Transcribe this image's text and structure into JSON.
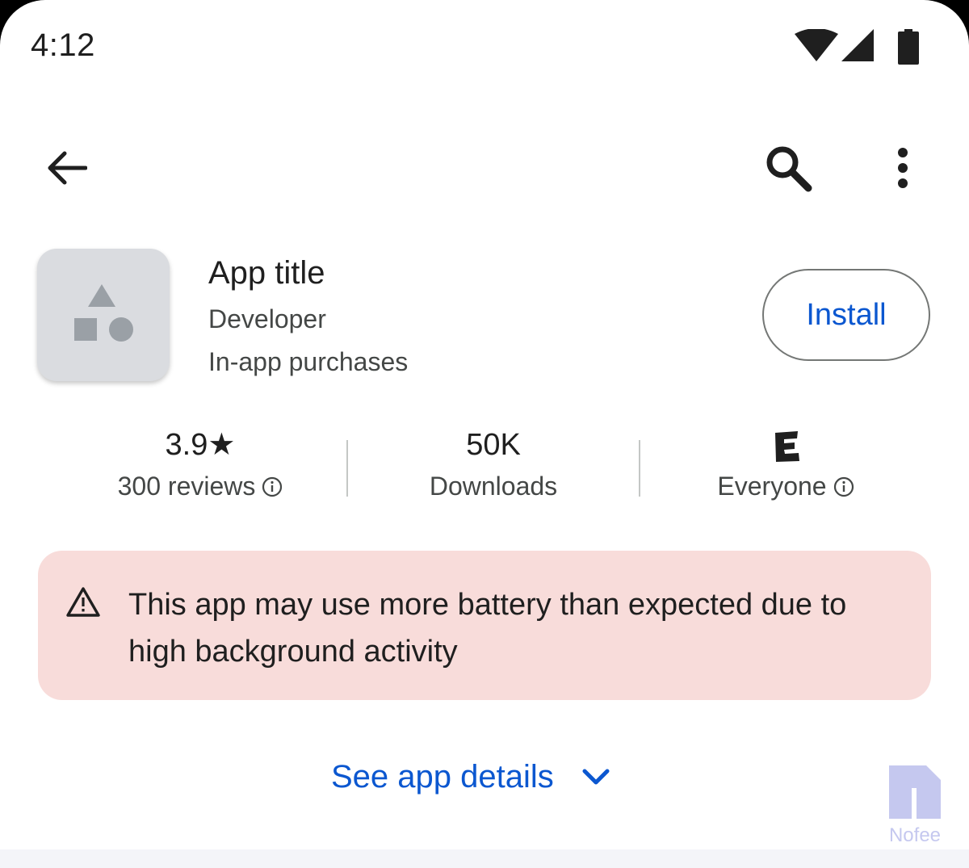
{
  "status_bar": {
    "time": "4:12",
    "icons": [
      "wifi-icon",
      "cellular-signal-icon",
      "battery-icon"
    ]
  },
  "top_bar": {
    "icons": [
      "back-arrow-icon",
      "search-icon",
      "more-vert-icon"
    ]
  },
  "app": {
    "title": "App title",
    "developer": "Developer",
    "purchases": "In-app purchases",
    "install_label": "Install",
    "icon": "app-placeholder-shapes-icon"
  },
  "stats": {
    "rating": "3.9★",
    "reviews": "300 reviews",
    "downloads_value": "50K",
    "downloads_label": "Downloads",
    "content_rating_label": "Everyone",
    "content_rating_icon": "esrb-e-icon"
  },
  "warning": {
    "text": "This app may use more battery than expected due to high background activity",
    "icon": "warning-triangle-icon"
  },
  "details_link": {
    "label": "See app details",
    "icon": "chevron-down-icon"
  },
  "watermark": {
    "text": "Nofee"
  },
  "colors": {
    "accent": "#0b57d0",
    "warning_bg": "#f8dcda",
    "icon_bg": "#dadce0",
    "text_primary": "#1f1f1f",
    "text_secondary": "#444746"
  }
}
